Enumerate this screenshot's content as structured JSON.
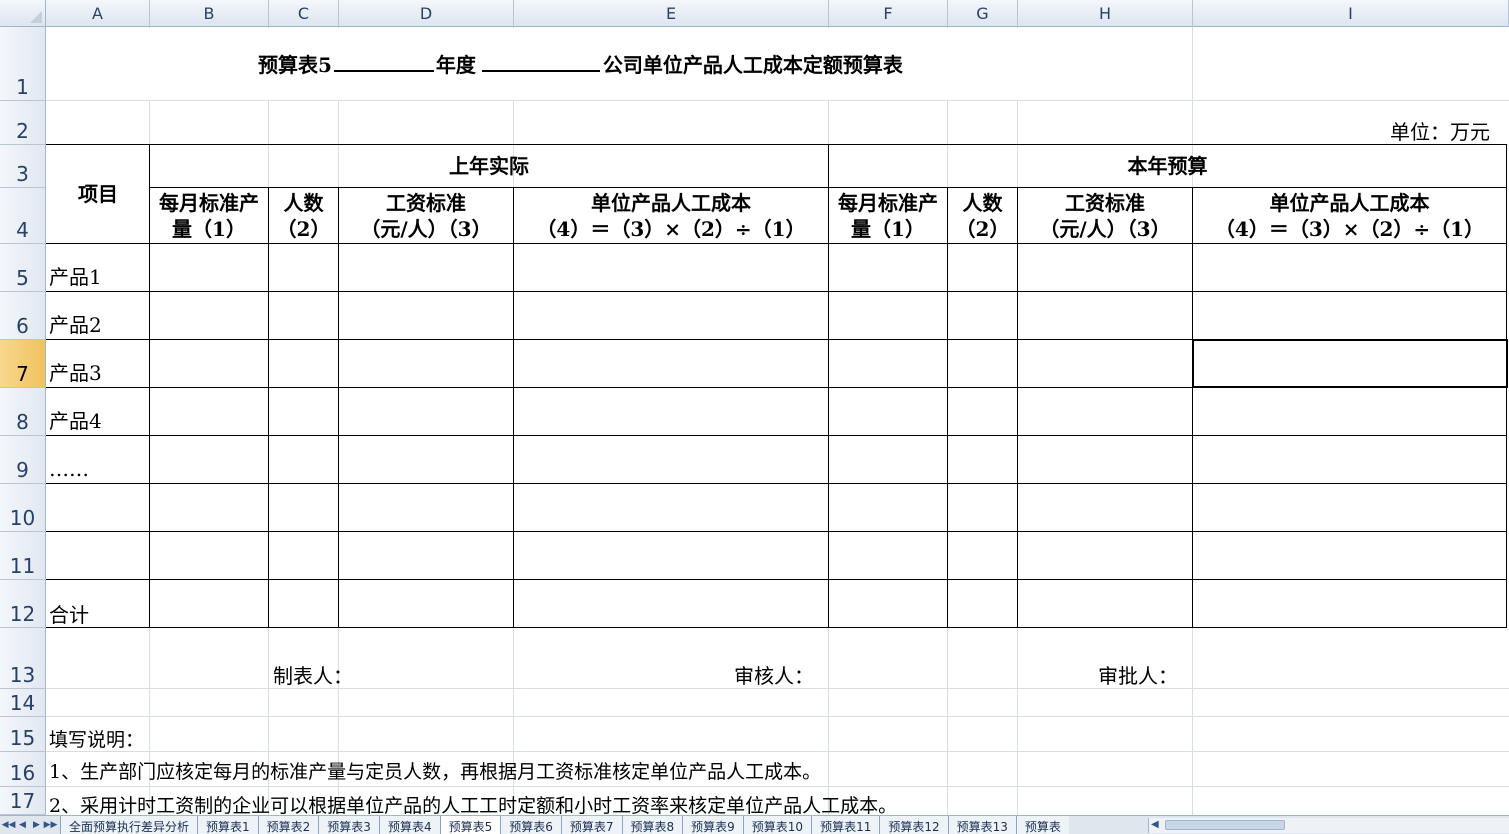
{
  "columns": [
    "A",
    "B",
    "C",
    "D",
    "E",
    "F",
    "G",
    "H",
    "I"
  ],
  "rows": [
    "1",
    "2",
    "3",
    "4",
    "5",
    "6",
    "7",
    "8",
    "9",
    "10",
    "11",
    "12",
    "13",
    "14",
    "15",
    "16",
    "17"
  ],
  "selected_row": "7",
  "title": {
    "prefix": "预算表5",
    "year_label": "年度",
    "suffix": "公司单位产品人工成本定额预算表"
  },
  "unit": "单位：万元",
  "header": {
    "item": "项目",
    "last_year": "上年实际",
    "this_year": "本年预算",
    "sub": [
      {
        "l1": "每月标准产",
        "l2": "量（1）"
      },
      {
        "l1": "人数",
        "l2": "（2）"
      },
      {
        "l1": "工资标准",
        "l2": "（元/人）（3）"
      },
      {
        "l1": "单位产品人工成本",
        "l2": "（4）＝（3）×（2）÷（1）"
      }
    ]
  },
  "items": [
    "产品1",
    "产品2",
    "产品3",
    "产品4",
    "……",
    "",
    "",
    "合计"
  ],
  "signatures": {
    "preparer": "制表人：",
    "reviewer": "审核人：",
    "approver": "审批人："
  },
  "notes": {
    "heading": "填写说明：",
    "line1": "1、生产部门应核定每月的标准产量与定员人数，再根据月工资标准核定单位产品人工成本。",
    "line2": "2、采用计时工资制的企业可以根据单位产品的人工工时定额和小时工资率来核定单位产品人工成本。"
  },
  "sheet_tabs": [
    "全面预算执行差异分析",
    "预算表1",
    "预算表2",
    "预算表3",
    "预算表4",
    "预算表5",
    "预算表6",
    "预算表7",
    "预算表8",
    "预算表9",
    "预算表10",
    "预算表11",
    "预算表12",
    "预算表13",
    "预算表"
  ],
  "active_tab": "预算表5",
  "colors": {
    "header_bg": "#dde5ef",
    "selected_row_bg": "#f1c15f",
    "grid": "#d8dde4"
  }
}
